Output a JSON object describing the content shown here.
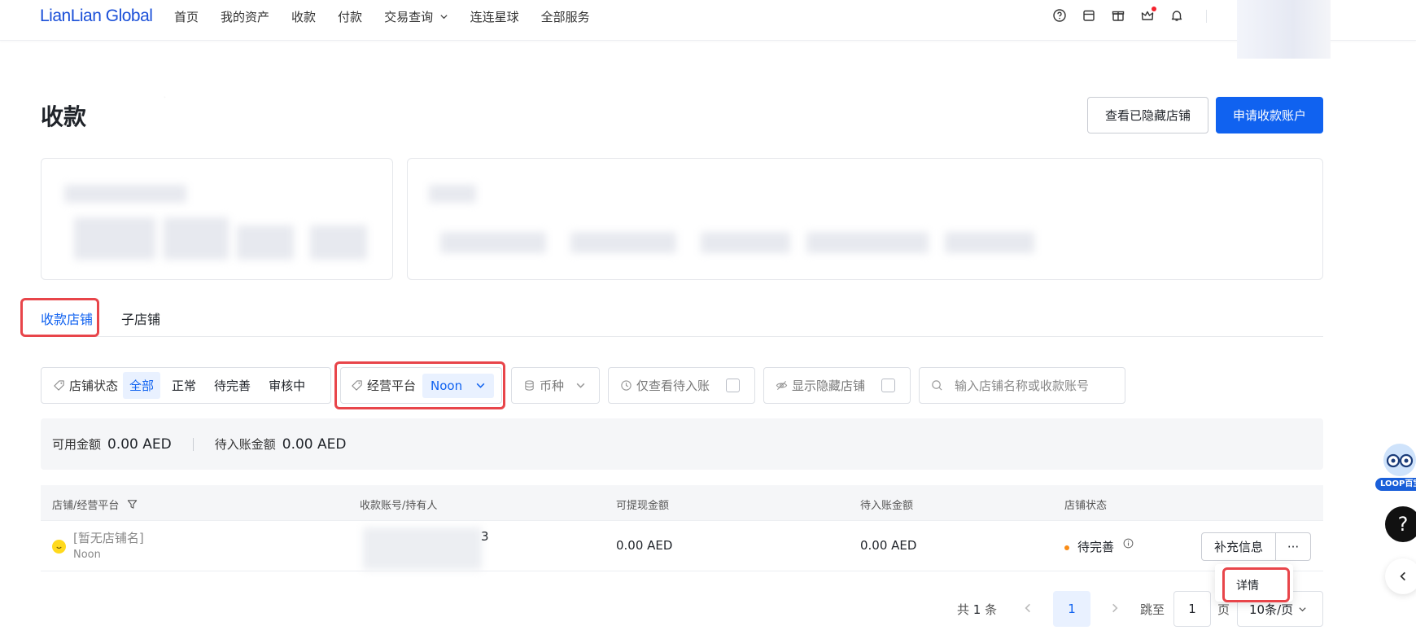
{
  "header": {
    "logo": "LianLian Global",
    "nav": [
      "首页",
      "我的资产",
      "收款",
      "付款",
      "交易查询",
      "连连星球",
      "全部服务"
    ]
  },
  "page": {
    "title": "收款",
    "view_hidden_button": "查看已隐藏店铺",
    "apply_button": "申请收款账户"
  },
  "tabs": {
    "items": [
      "收款店铺",
      "子店铺"
    ],
    "active": 0
  },
  "filters": {
    "status_label": "店铺状态",
    "status_options": [
      "全部",
      "正常",
      "待完善",
      "审核中"
    ],
    "platform_label": "经营平台",
    "platform_value": "Noon",
    "currency_label": "币种",
    "pending_only_label": "仅查看待入账",
    "show_hidden_label": "显示隐藏店铺",
    "search_placeholder": "输入店铺名称或收款账号"
  },
  "summary": {
    "available_label": "可用金额",
    "available_value": "0.00 AED",
    "pending_label": "待入账金额",
    "pending_value": "0.00 AED"
  },
  "table": {
    "columns": [
      "店铺/经营平台",
      "收款账号/持有人",
      "可提现金额",
      "待入账金额",
      "店铺状态"
    ],
    "rows": [
      {
        "store_name": "[暂无店铺名]",
        "platform": "Noon",
        "account_suffix": "3",
        "withdrawable": "0.00 AED",
        "pending": "0.00 AED",
        "status": "待完善",
        "action_label": "补充信息",
        "more_label": "···"
      }
    ]
  },
  "dropdown": {
    "items": [
      "详情"
    ]
  },
  "pagination": {
    "total_prefix": "共",
    "total": "1",
    "total_suffix": "条",
    "current": "1",
    "jump_label": "跳至",
    "jump_value": "1",
    "page_suffix": "页",
    "page_size": "10条/页"
  },
  "side": {
    "loop_label": "LOOP百宝",
    "help_label": "?"
  },
  "colors": {
    "primary": "#1062f0",
    "highlight": "#e8454a",
    "warning": "#fa8c16"
  }
}
